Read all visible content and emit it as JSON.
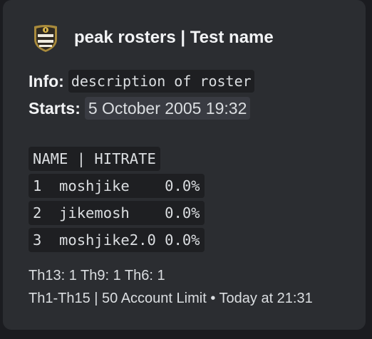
{
  "author": {
    "icon": "helmet-shield-icon",
    "name": "peak rosters | Test name"
  },
  "description": {
    "info_label": "Info:",
    "info_value": "description of roster",
    "starts_label": "Starts:",
    "starts_value": "5 October 2005 19:32"
  },
  "table": {
    "header": "NAME | HITRATE",
    "rows": [
      "1  moshjike    0.0%",
      "2  jikemosh    0.0%",
      "3  moshjike2.0 0.0%"
    ]
  },
  "footer": {
    "line1": "Th13: 1 Th9: 1 Th6: 1",
    "line2": "Th1-Th15 | 50 Account Limit • Today at 21:31"
  },
  "colors": {
    "background": "#1b1c20",
    "embed": "#2b2d31",
    "code_bg": "#1e1f22",
    "timestamp_bg": "#393b42"
  }
}
